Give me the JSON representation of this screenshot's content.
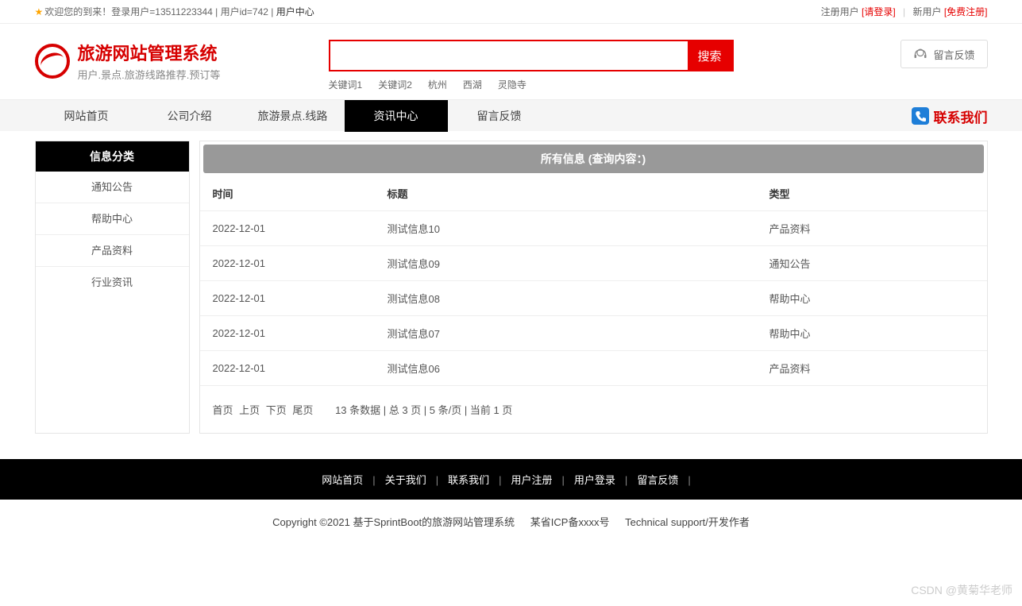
{
  "topbar": {
    "welcome": "欢迎您的到来！登录用户=13511223344 | 用户id=742 | ",
    "user_center": "用户中心",
    "registered_user": "注册用户",
    "login": "[请登录]",
    "new_user": "新用户",
    "free_register": "[免费注册]"
  },
  "logo": {
    "title": "旅游网站管理系统",
    "subtitle": "用户.景点.旅游线路推荐.预订等"
  },
  "search": {
    "button": "搜索",
    "placeholder": "",
    "keywords": [
      "关键词1",
      "关键词2",
      "杭州",
      "西湖",
      "灵隐寺"
    ]
  },
  "feedback_btn": "留言反馈",
  "nav": {
    "items": [
      "网站首页",
      "公司介绍",
      "旅游景点.线路",
      "资讯中心",
      "留言反馈"
    ],
    "active_index": 3,
    "contact": "联系我们"
  },
  "sidebar": {
    "header": "信息分类",
    "items": [
      "通知公告",
      "帮助中心",
      "产品资料",
      "行业资讯"
    ]
  },
  "content": {
    "header": "所有信息 (查询内容：)",
    "columns": [
      "时间",
      "标题",
      "类型"
    ],
    "rows": [
      {
        "time": "2022-12-01",
        "title": "测试信息10",
        "type": "产品资料"
      },
      {
        "time": "2022-12-01",
        "title": "测试信息09",
        "type": "通知公告"
      },
      {
        "time": "2022-12-01",
        "title": "测试信息08",
        "type": "帮助中心"
      },
      {
        "time": "2022-12-01",
        "title": "测试信息07",
        "type": "帮助中心"
      },
      {
        "time": "2022-12-01",
        "title": "测试信息06",
        "type": "产品资料"
      }
    ]
  },
  "pagination": {
    "first": "首页",
    "prev": "上页",
    "next": "下页",
    "last": "尾页",
    "info": "13 条数据 | 总 3 页 | 5 条/页 | 当前 1 页"
  },
  "footer_nav": [
    "网站首页",
    "关于我们",
    "联系我们",
    "用户注册",
    "用户登录",
    "留言反馈"
  ],
  "copyright": {
    "text": "Copyright ©2021 基于SprintBoot的旅游网站管理系统",
    "icp": "某省ICP备xxxx号",
    "support": "Technical support/开发作者"
  },
  "watermark": "CSDN @黄菊华老师"
}
